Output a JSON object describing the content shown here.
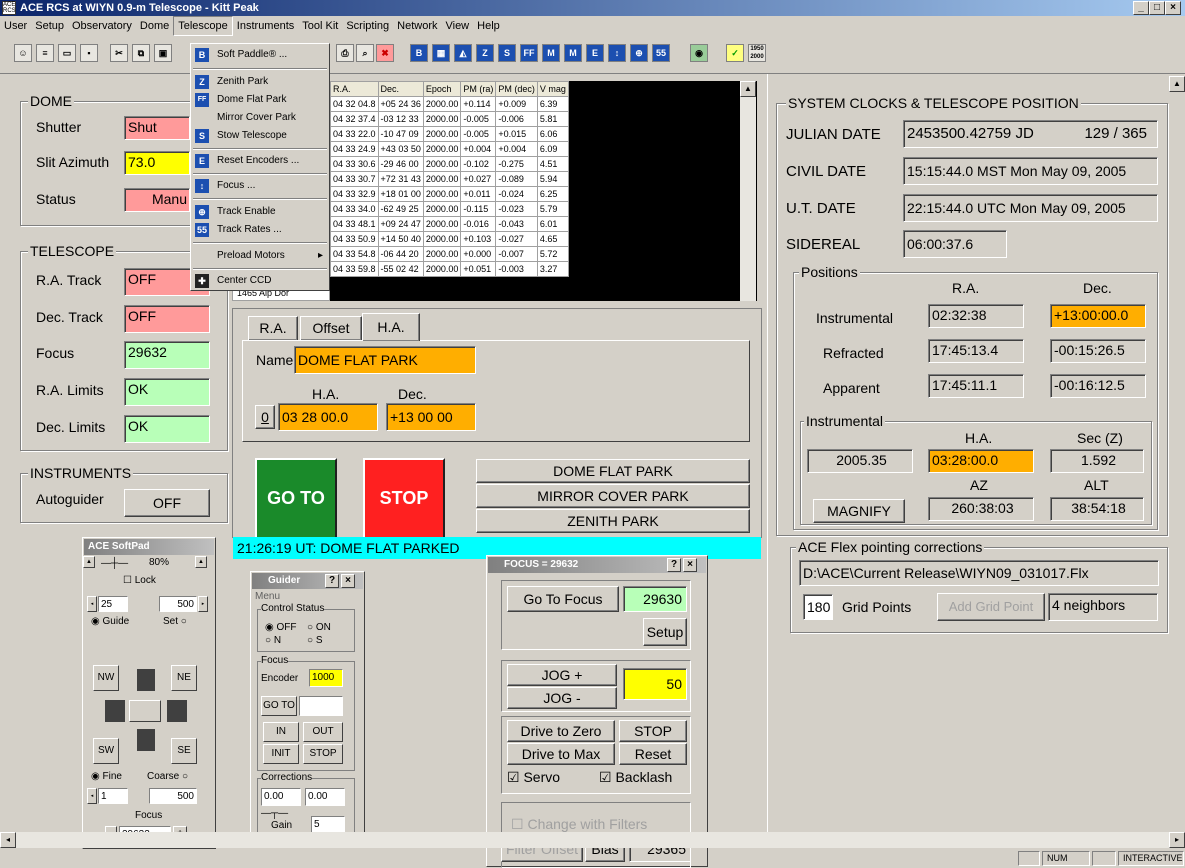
{
  "window": {
    "title": "ACE RCS at WIYN 0.9-m Telescope - Kitt Peak",
    "icon_text": "ACE RCS"
  },
  "menu": [
    "User",
    "Setup",
    "Observatory",
    "Dome",
    "Telescope",
    "Instruments",
    "Tool Kit",
    "Scripting",
    "Network",
    "View",
    "Help"
  ],
  "telescope_menu": {
    "items": [
      {
        "label": "Soft Paddle® ...",
        "icon": "B"
      },
      {
        "label": "Zenith Park",
        "icon": "Z"
      },
      {
        "label": "Dome Flat Park",
        "icon": "FF"
      },
      {
        "label": "Mirror Cover Park",
        "icon": ""
      },
      {
        "label": "Stow Telescope",
        "icon": "S"
      },
      {
        "label": "Reset Encoders ...",
        "icon": "E"
      },
      {
        "label": "Focus ...",
        "icon": "↕"
      },
      {
        "label": "Track Enable",
        "icon": "⊕"
      },
      {
        "label": "Track Rates ...",
        "icon": "55"
      },
      {
        "label": "Preload Motors",
        "icon": ""
      },
      {
        "label": "Center CCD",
        "icon": "■"
      }
    ]
  },
  "dome": {
    "title": "DOME",
    "shutter_label": "Shutter",
    "shutter_value": "Shut",
    "slit_label": "Slit Azimuth",
    "slit_value": "73.0",
    "status_label": "Status",
    "status_value": "Manu"
  },
  "telescope": {
    "title": "TELESCOPE",
    "ra_track_label": "R.A. Track",
    "ra_track_value": "OFF",
    "dec_track_label": "Dec. Track",
    "dec_track_value": "OFF",
    "focus_label": "Focus",
    "focus_value": "29632",
    "ra_limits_label": "R.A. Limits",
    "ra_limits_value": "OK",
    "dec_limits_label": "Dec. Limits",
    "dec_limits_value": "OK"
  },
  "instruments": {
    "title": "INSTRUMENTS",
    "autoguider_label": "Autoguider",
    "autoguider_value": "OFF"
  },
  "star_table": {
    "headers": [
      "R.A.",
      "Dec.",
      "Epoch",
      "PM (ra)",
      "PM (dec)",
      "V mag"
    ],
    "rows": [
      [
        "04 32 04.8",
        "+05 24 36",
        "2000.00",
        "+0.114",
        "+0.009",
        "6.39"
      ],
      [
        "04 32 37.4",
        "-03 12 33",
        "2000.00",
        "-0.005",
        "-0.006",
        "5.81"
      ],
      [
        "04 33 22.0",
        "-10 47 09",
        "2000.00",
        "-0.005",
        "+0.015",
        "6.06"
      ],
      [
        "04 33 24.9",
        "+43 03 50",
        "2000.00",
        "+0.004",
        "+0.004",
        "6.09"
      ],
      [
        "04 33 30.6",
        "-29 46 00",
        "2000.00",
        "-0.102",
        "-0.275",
        "4.51"
      ],
      [
        "04 33 30.7",
        "+72 31 43",
        "2000.00",
        "+0.027",
        "-0.089",
        "5.94"
      ],
      [
        "04 33 32.9",
        "+18 01 00",
        "2000.00",
        "+0.011",
        "-0.024",
        "6.25"
      ],
      [
        "04 33 34.0",
        "-62 49 25",
        "2000.00",
        "-0.115",
        "-0.023",
        "5.79"
      ],
      [
        "04 33 48.1",
        "+09 24 47",
        "2000.00",
        "-0.016",
        "-0.043",
        "6.01"
      ],
      [
        "04 33 50.9",
        "+14 50 40",
        "2000.00",
        "+0.103",
        "-0.027",
        "4.65"
      ],
      [
        "04 33 54.8",
        "-06 44 20",
        "2000.00",
        "+0.000",
        "-0.007",
        "5.72"
      ],
      [
        "04 33 59.8",
        "-55 02 42",
        "2000.00",
        "+0.051",
        "-0.003",
        "3.27"
      ]
    ],
    "last_name": "1465  Alp Dor"
  },
  "target": {
    "tabs": [
      "R.A.",
      "Offset",
      "H.A."
    ],
    "name_label": "Name",
    "name_value": "DOME FLAT PARK",
    "ha_label": "H.A.",
    "dec_label": "Dec.",
    "zero_btn": "0",
    "ha_value": "03 28 00.0",
    "dec_value": "+13 00 00",
    "goto_label": "GO TO",
    "stop_label": "STOP",
    "park_buttons": [
      "DOME FLAT PARK",
      "MIRROR COVER PARK",
      "ZENITH PARK"
    ],
    "status_msg": "21:26:19 UT:  DOME FLAT PARKED"
  },
  "clocks": {
    "title": "SYSTEM CLOCKS & TELESCOPE POSITION",
    "julian_label": "JULIAN DATE",
    "julian_value": "2453500.42759  JD",
    "julian_day": "129 / 365",
    "civil_label": "CIVIL DATE",
    "civil_value": "15:15:44.0 MST   Mon May 09, 2005",
    "ut_label": "U.T.  DATE",
    "ut_value": "22:15:44.0 UTC   Mon May 09, 2005",
    "sidereal_label": "SIDEREAL",
    "sidereal_value": "06:00:37.6"
  },
  "positions": {
    "title": "Positions",
    "ra_header": "R.A.",
    "dec_header": "Dec.",
    "instrumental_label": "Instrumental",
    "instrumental_ra": "02:32:38",
    "instrumental_dec": "+13:00:00.0",
    "refracted_label": "Refracted",
    "refracted_ra": "17:45:13.4",
    "refracted_dec": "-00:15:26.5",
    "apparent_label": "Apparent",
    "apparent_ra": "17:45:11.1",
    "apparent_dec": "-00:16:12.5"
  },
  "instrumental": {
    "title": "Instrumental",
    "ha_header": "H.A.",
    "secz_header": "Sec (Z)",
    "value1": "2005.35",
    "ha_value": "03:28:00.0",
    "secz_value": "1.592",
    "az_header": "AZ",
    "alt_header": "ALT",
    "magnify_label": "MAGNIFY",
    "az_value": "260:38:03",
    "alt_value": "38:54:18"
  },
  "flex": {
    "title": "ACE Flex pointing corrections",
    "path": "D:\\ACE\\Current Release\\WIYN09_031017.Flx",
    "grid_value": "180",
    "grid_label": "Grid Points",
    "add_grid_label": "Add Grid Point",
    "neighbors": "4 neighbors"
  },
  "softpad": {
    "title": "ACE SoftPad",
    "speed": "80%",
    "lock_label": "Lock",
    "step_a": "25",
    "step_b": "500",
    "guide_label": "Guide",
    "set_label": "Set",
    "nw": "NW",
    "ne": "NE",
    "sw": "SW",
    "se": "SE",
    "fine_label": "Fine",
    "coarse_label": "Coarse",
    "fine_value": "1",
    "coarse_value": "500",
    "focus_label": "Focus",
    "focus_value": "29632",
    "minus": "-",
    "plus": "+"
  },
  "guider": {
    "title": "Guider",
    "menu_label": "Menu",
    "control_status": "Control Status",
    "off": "OFF",
    "on": "ON",
    "n": "N",
    "s": "S",
    "focus_label": "Focus",
    "encoder_label": "Encoder",
    "encoder_value": "1000",
    "goto_label": "GO TO",
    "in_label": "IN",
    "out_label": "OUT",
    "init_label": "INIT",
    "stop_label": "STOP",
    "corrections_label": "Corrections",
    "corr_a": "0.00",
    "corr_b": "0.00",
    "gain_label": "Gain",
    "gain_value": "5",
    "help_btn": "?",
    "close_btn": "×"
  },
  "focus_win": {
    "title": "FOCUS = 29632",
    "goto_focus": "Go To Focus",
    "focus_value": "29630",
    "setup": "Setup",
    "jog_plus": "JOG +",
    "jog_minus": "JOG -",
    "jog_value": "50",
    "drive_zero": "Drive to Zero",
    "stop": "STOP",
    "drive_max": "Drive to Max",
    "reset": "Reset",
    "servo": "Servo",
    "backlash": "Backlash",
    "change_filters": "Change with Filters",
    "filter_offset": "Filter Offset",
    "bias": "Bias",
    "bias_value": "29365"
  },
  "statusbar": {
    "num": "NUM",
    "mode": "INTERACTIVE"
  }
}
